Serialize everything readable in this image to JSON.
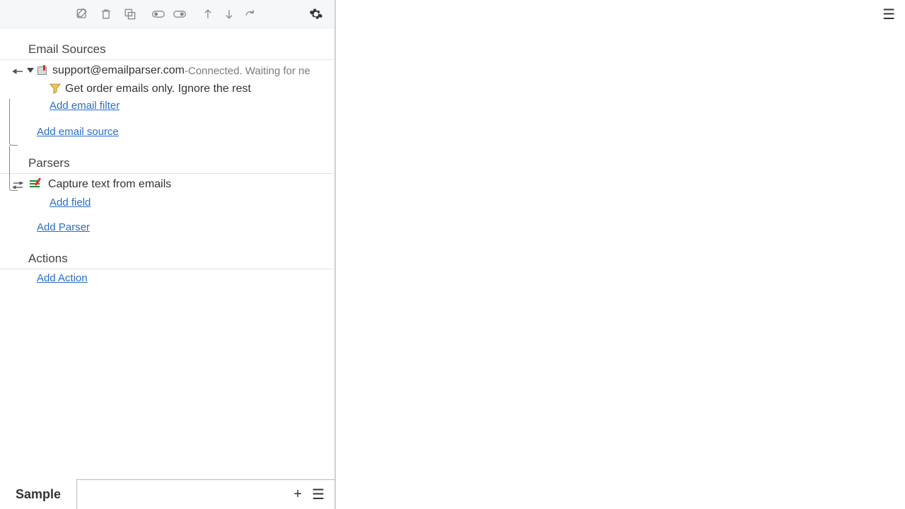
{
  "toolbar": {
    "icons": {
      "edit": "edit-icon",
      "delete": "trash-icon",
      "copy": "copy-icon",
      "toggle_on": "toggle-icon",
      "toggle_link": "toggle-link-icon",
      "sort_up": "arrow-up-icon",
      "sort_down": "arrow-down-icon",
      "redo": "redo-arrow-icon",
      "settings": "gear-icon"
    }
  },
  "sections": {
    "email_sources": {
      "title": "Email Sources",
      "source": {
        "address": "support@emailparser.com",
        "status_separator": " - ",
        "status": "Connected. Waiting for ne"
      },
      "filter": {
        "label": "Get order emails only. Ignore the rest"
      },
      "add_filter": "Add email filter",
      "add_source": "Add email source"
    },
    "parsers": {
      "title": "Parsers",
      "parser": {
        "label": "Capture text from emails"
      },
      "add_field": "Add field",
      "add_parser": "Add Parser"
    },
    "actions": {
      "title": "Actions",
      "add_action": "Add Action"
    }
  },
  "tabs": {
    "active": "Sample"
  }
}
